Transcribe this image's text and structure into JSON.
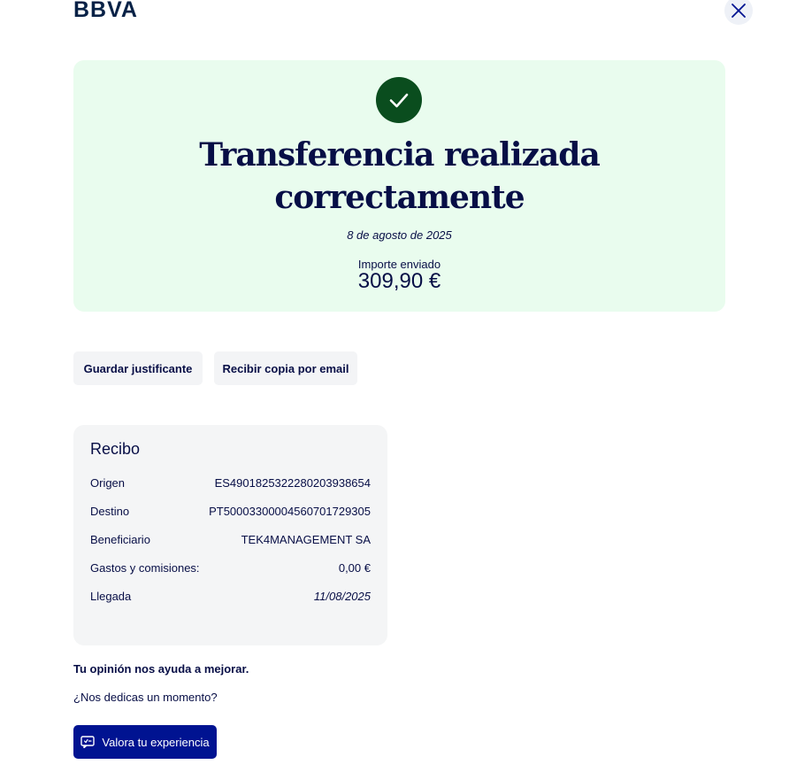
{
  "header": {
    "logo_text": "BBVA"
  },
  "success": {
    "title": "Transferencia realizada correctamente",
    "date": "8 de agosto de 2025",
    "amount_label": "Importe enviado",
    "amount_value": "309,90 €"
  },
  "actions": {
    "save_label": "Guardar justificante",
    "email_label": "Recibir copia por email"
  },
  "receipt": {
    "title": "Recibo",
    "rows": [
      {
        "label": "Origen",
        "value": "ES4901825322280203938654"
      },
      {
        "label": "Destino",
        "value": "PT50003300004560701729305"
      },
      {
        "label": "Beneficiario",
        "value": "TEK4MANAGEMENT SA"
      },
      {
        "label": "Gastos y comisiones:",
        "value": "0,00 €"
      },
      {
        "label": "Llegada",
        "value": "11/08/2025"
      }
    ]
  },
  "feedback": {
    "title": "Tu opinión nos ayuda a mejorar.",
    "subtitle": "¿Nos dedicas un momento?",
    "button_label": "Valora tu experiencia"
  },
  "colors": {
    "brand_navy": "#070e46",
    "success_bg": "#e9fcee",
    "success_icon": "#0a4d1e",
    "primary_button": "#001391"
  },
  "icons": {
    "close": "close-icon",
    "check": "check-icon",
    "feedback": "feedback-icon"
  }
}
